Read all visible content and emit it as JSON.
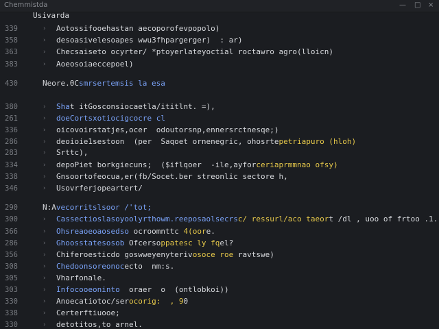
{
  "window": {
    "title": "Chemmistda",
    "minimize_glyph": "—",
    "maximize_glyph": "□",
    "close_glyph": "×"
  },
  "tab": {
    "label": "Usivarda"
  },
  "lines": [
    {
      "num": "339",
      "text": "Aotossifooehastan aecoporofevpopolo)"
    },
    {
      "num": "358",
      "text": "desoasivelesoapes wwu3fhpargerger)  : ar)"
    },
    {
      "num": "363",
      "text": "Checsaiseto ocyrter/ *ptoyerlateyoctial roctawro agro(lloicn)"
    },
    {
      "num": "383",
      "text": "Aoeosoiaeccepoel)"
    },
    {
      "num": "430",
      "text": "Neore.0Csmrsertemsis la esa"
    },
    {
      "num": "380",
      "text": "Shat itGosconsiocaetla/ititlnt. =),"
    },
    {
      "num": "261",
      "text": "doeCortsxotiocigcocre cl"
    },
    {
      "num": "336",
      "text": "oicovoirstatjes,ocer  odoutorsnp,ennersrctnesqe;)"
    },
    {
      "num": "286",
      "text": "deoioie1sestoon  (per  Saqoet ornenegric, ohosrtepetriapuro (hloh)"
    },
    {
      "num": "283",
      "text": "Srttc),"
    },
    {
      "num": "334",
      "text": "depoPiet borkgiecuns;  ($iflqoer  -ile,ayforceriaprmmnao ofsy)"
    },
    {
      "num": "338",
      "text": "Gnsoortofeocua,er(fb/Socet.ber streonlic sectore h,"
    },
    {
      "num": "346",
      "text": "Usovrferjopeartert/"
    },
    {
      "num": "290",
      "text": "N:Avecorritslsoor /'tot;"
    },
    {
      "num": "300",
      "text": "Cassectioslasoyoolyrthowm.reeposaolsecrsc/ ressurl/aco taeort /dl , uoo of frtoo .1."
    },
    {
      "num": "366",
      "text": "Ohsreaoeoaosedso ocroomnttc 4(oore."
    },
    {
      "num": "286",
      "text": "Ghoosstatesosob Ofcersoppatesc ly fqel?"
    },
    {
      "num": "356",
      "text": "Chiferoesticdo goswweyenyterivosoce roe ravtswe)"
    },
    {
      "num": "308",
      "text": "Chedoonsoreonocecto  nm:s."
    },
    {
      "num": "305",
      "text": "Vharfonale."
    },
    {
      "num": "303",
      "text": "Infocooeoninto  oraer  o  (ontlobkoi))"
    },
    {
      "num": "330",
      "text": "Anoecatiotoc/serocorig:  , 90"
    },
    {
      "num": "338",
      "text": "Certerftiuooe;"
    },
    {
      "num": "330",
      "text": "detotitos,to arnel."
    }
  ],
  "colors": {
    "background": "#1b1d21",
    "titlebar": "#202226",
    "text": "#d6d8dc",
    "line_number": "#7a7d83",
    "keyword_blue": "#7aa2f7",
    "string_yellow": "#e6c84a",
    "accent_orange": "#e0903c"
  }
}
